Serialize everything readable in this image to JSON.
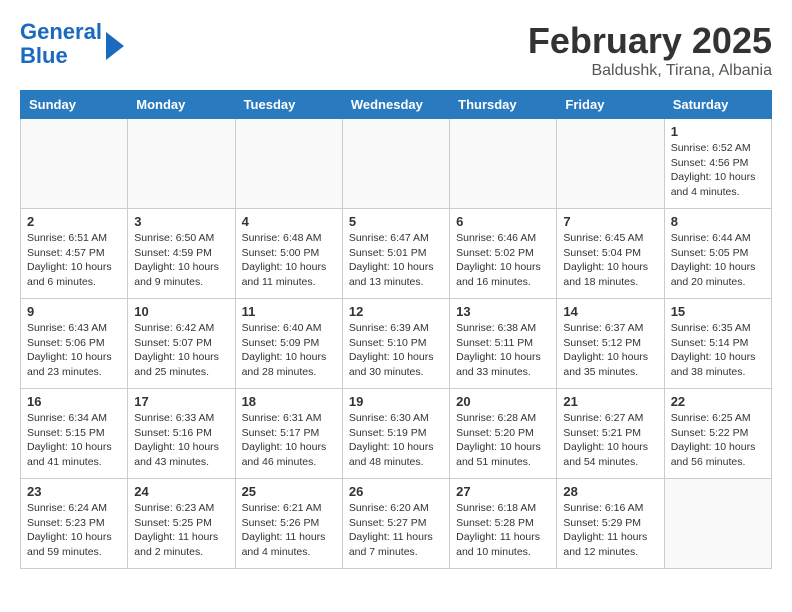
{
  "logo": {
    "line1": "General",
    "line2": "Blue"
  },
  "title": "February 2025",
  "location": "Baldushk, Tirana, Albania",
  "weekdays": [
    "Sunday",
    "Monday",
    "Tuesday",
    "Wednesday",
    "Thursday",
    "Friday",
    "Saturday"
  ],
  "weeks": [
    [
      {
        "day": "",
        "info": ""
      },
      {
        "day": "",
        "info": ""
      },
      {
        "day": "",
        "info": ""
      },
      {
        "day": "",
        "info": ""
      },
      {
        "day": "",
        "info": ""
      },
      {
        "day": "",
        "info": ""
      },
      {
        "day": "1",
        "info": "Sunrise: 6:52 AM\nSunset: 4:56 PM\nDaylight: 10 hours\nand 4 minutes."
      }
    ],
    [
      {
        "day": "2",
        "info": "Sunrise: 6:51 AM\nSunset: 4:57 PM\nDaylight: 10 hours\nand 6 minutes."
      },
      {
        "day": "3",
        "info": "Sunrise: 6:50 AM\nSunset: 4:59 PM\nDaylight: 10 hours\nand 9 minutes."
      },
      {
        "day": "4",
        "info": "Sunrise: 6:48 AM\nSunset: 5:00 PM\nDaylight: 10 hours\nand 11 minutes."
      },
      {
        "day": "5",
        "info": "Sunrise: 6:47 AM\nSunset: 5:01 PM\nDaylight: 10 hours\nand 13 minutes."
      },
      {
        "day": "6",
        "info": "Sunrise: 6:46 AM\nSunset: 5:02 PM\nDaylight: 10 hours\nand 16 minutes."
      },
      {
        "day": "7",
        "info": "Sunrise: 6:45 AM\nSunset: 5:04 PM\nDaylight: 10 hours\nand 18 minutes."
      },
      {
        "day": "8",
        "info": "Sunrise: 6:44 AM\nSunset: 5:05 PM\nDaylight: 10 hours\nand 20 minutes."
      }
    ],
    [
      {
        "day": "9",
        "info": "Sunrise: 6:43 AM\nSunset: 5:06 PM\nDaylight: 10 hours\nand 23 minutes."
      },
      {
        "day": "10",
        "info": "Sunrise: 6:42 AM\nSunset: 5:07 PM\nDaylight: 10 hours\nand 25 minutes."
      },
      {
        "day": "11",
        "info": "Sunrise: 6:40 AM\nSunset: 5:09 PM\nDaylight: 10 hours\nand 28 minutes."
      },
      {
        "day": "12",
        "info": "Sunrise: 6:39 AM\nSunset: 5:10 PM\nDaylight: 10 hours\nand 30 minutes."
      },
      {
        "day": "13",
        "info": "Sunrise: 6:38 AM\nSunset: 5:11 PM\nDaylight: 10 hours\nand 33 minutes."
      },
      {
        "day": "14",
        "info": "Sunrise: 6:37 AM\nSunset: 5:12 PM\nDaylight: 10 hours\nand 35 minutes."
      },
      {
        "day": "15",
        "info": "Sunrise: 6:35 AM\nSunset: 5:14 PM\nDaylight: 10 hours\nand 38 minutes."
      }
    ],
    [
      {
        "day": "16",
        "info": "Sunrise: 6:34 AM\nSunset: 5:15 PM\nDaylight: 10 hours\nand 41 minutes."
      },
      {
        "day": "17",
        "info": "Sunrise: 6:33 AM\nSunset: 5:16 PM\nDaylight: 10 hours\nand 43 minutes."
      },
      {
        "day": "18",
        "info": "Sunrise: 6:31 AM\nSunset: 5:17 PM\nDaylight: 10 hours\nand 46 minutes."
      },
      {
        "day": "19",
        "info": "Sunrise: 6:30 AM\nSunset: 5:19 PM\nDaylight: 10 hours\nand 48 minutes."
      },
      {
        "day": "20",
        "info": "Sunrise: 6:28 AM\nSunset: 5:20 PM\nDaylight: 10 hours\nand 51 minutes."
      },
      {
        "day": "21",
        "info": "Sunrise: 6:27 AM\nSunset: 5:21 PM\nDaylight: 10 hours\nand 54 minutes."
      },
      {
        "day": "22",
        "info": "Sunrise: 6:25 AM\nSunset: 5:22 PM\nDaylight: 10 hours\nand 56 minutes."
      }
    ],
    [
      {
        "day": "23",
        "info": "Sunrise: 6:24 AM\nSunset: 5:23 PM\nDaylight: 10 hours\nand 59 minutes."
      },
      {
        "day": "24",
        "info": "Sunrise: 6:23 AM\nSunset: 5:25 PM\nDaylight: 11 hours\nand 2 minutes."
      },
      {
        "day": "25",
        "info": "Sunrise: 6:21 AM\nSunset: 5:26 PM\nDaylight: 11 hours\nand 4 minutes."
      },
      {
        "day": "26",
        "info": "Sunrise: 6:20 AM\nSunset: 5:27 PM\nDaylight: 11 hours\nand 7 minutes."
      },
      {
        "day": "27",
        "info": "Sunrise: 6:18 AM\nSunset: 5:28 PM\nDaylight: 11 hours\nand 10 minutes."
      },
      {
        "day": "28",
        "info": "Sunrise: 6:16 AM\nSunset: 5:29 PM\nDaylight: 11 hours\nand 12 minutes."
      },
      {
        "day": "",
        "info": ""
      }
    ]
  ]
}
